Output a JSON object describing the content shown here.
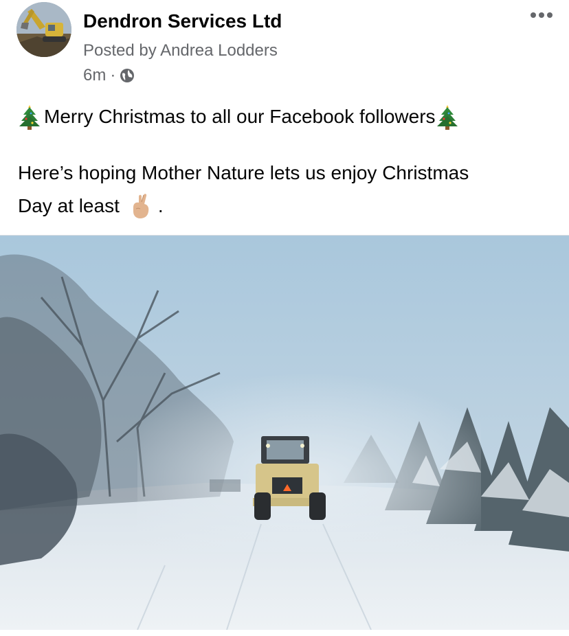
{
  "post": {
    "page_name": "Dendron Services Ltd",
    "posted_by": "Posted by Andrea Lodders",
    "time": "6m",
    "separator": "·",
    "privacy_icon": "globe-icon",
    "more_icon": "more-options-icon",
    "text": {
      "line1": "Merry Christmas to all our Facebook followers",
      "line2": "Here’s hoping Mother Nature lets us enjoy Christmas",
      "line3": "Day at least",
      "line3_end": "."
    },
    "emojis": [
      "christmas-tree-icon",
      "crossed-fingers-icon"
    ]
  },
  "colors": {
    "text": "#050505",
    "secondary": "#65676b",
    "sky": "#b9d0df",
    "snow": "#e6edf2",
    "machine": "#d9c98a"
  }
}
